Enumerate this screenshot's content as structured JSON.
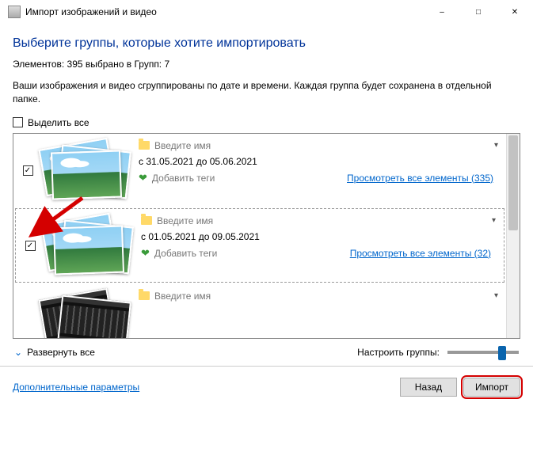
{
  "window": {
    "title": "Импорт изображений и видео"
  },
  "heading": "Выберите группы, которые хотите импортировать",
  "summary": "Элементов: 395 выбрано в Групп: 7",
  "description": "Ваши изображения и видео сгруппированы по дате и времени. Каждая группа будет сохранена в отдельной папке.",
  "select_all_label": "Выделить все",
  "name_placeholder": "Введите имя",
  "add_tags_label": "Добавить теги",
  "groups": [
    {
      "checked": true,
      "date_range": "с 31.05.2021 до 05.06.2021",
      "view_all": "Просмотреть все элементы (335)"
    },
    {
      "checked": true,
      "date_range": "с 01.05.2021 до 09.05.2021",
      "view_all": "Просмотреть все элементы (32)"
    },
    {
      "checked": true,
      "date_range": "",
      "view_all": ""
    }
  ],
  "expand_all": "Развернуть все",
  "adjust_groups": "Настроить группы:",
  "more_options": "Дополнительные параметры",
  "buttons": {
    "back": "Назад",
    "import": "Импорт"
  }
}
